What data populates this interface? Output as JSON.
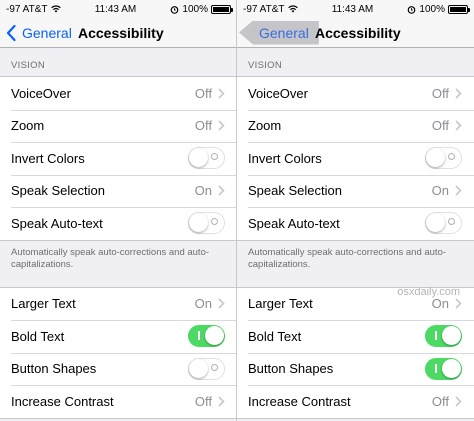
{
  "left": {
    "status": {
      "carrier": "-97 AT&T",
      "time": "11:43 AM",
      "battery": "100%",
      "battery_level": 1.0
    },
    "nav": {
      "back_label": "General",
      "title": "Accessibility"
    },
    "vision": {
      "header": "VISION",
      "rows": [
        {
          "label": "VoiceOver",
          "value": "Off"
        },
        {
          "label": "Zoom",
          "value": "Off"
        },
        {
          "label": "Invert Colors",
          "toggle": "off"
        },
        {
          "label": "Speak Selection",
          "value": "On"
        },
        {
          "label": "Speak Auto-text",
          "toggle": "off"
        }
      ],
      "footer": "Automatically speak auto-corrections and auto-capitalizations."
    },
    "text": {
      "rows": [
        {
          "label": "Larger Text",
          "value": "On"
        },
        {
          "label": "Bold Text",
          "toggle": "on"
        },
        {
          "label": "Button Shapes",
          "toggle": "off"
        },
        {
          "label": "Increase Contrast",
          "value": "Off"
        }
      ]
    }
  },
  "right": {
    "status": {
      "carrier": "-97 AT&T",
      "time": "11:43 AM",
      "battery": "100%",
      "battery_level": 1.0
    },
    "nav": {
      "back_label": "General",
      "title": "Accessibility"
    },
    "vision": {
      "header": "VISION",
      "rows": [
        {
          "label": "VoiceOver",
          "value": "Off"
        },
        {
          "label": "Zoom",
          "value": "Off"
        },
        {
          "label": "Invert Colors",
          "toggle": "off"
        },
        {
          "label": "Speak Selection",
          "value": "On"
        },
        {
          "label": "Speak Auto-text",
          "toggle": "off"
        }
      ],
      "footer": "Automatically speak auto-corrections and auto-capitalizations."
    },
    "text": {
      "rows": [
        {
          "label": "Larger Text",
          "value": "On"
        },
        {
          "label": "Bold Text",
          "toggle": "on"
        },
        {
          "label": "Button Shapes",
          "toggle": "on"
        },
        {
          "label": "Increase Contrast",
          "value": "Off"
        }
      ]
    }
  },
  "watermark": "osxdaily.com",
  "colors": {
    "accent": "#0a60ff",
    "toggle_on": "#4cd964",
    "background": "#efeff4",
    "secondary_text": "#8e8e93"
  }
}
